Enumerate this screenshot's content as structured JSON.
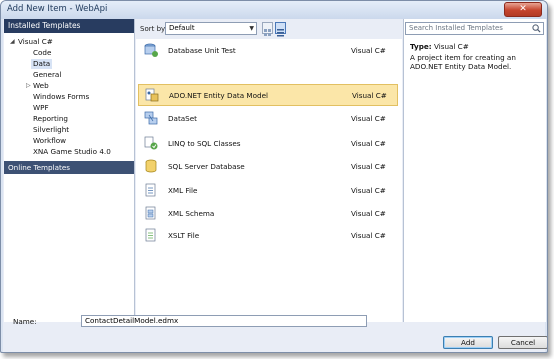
{
  "window": {
    "title": "Add New Item - WebApi",
    "close_glyph": "✕"
  },
  "left": {
    "header": "Installed Templates",
    "tree": [
      {
        "label": "Visual C#",
        "expander": "◢"
      },
      {
        "label": "Code"
      },
      {
        "label": "Data",
        "selected": true
      },
      {
        "label": "General"
      },
      {
        "label": "Web",
        "expander": "▷"
      },
      {
        "label": "Windows Forms"
      },
      {
        "label": "WPF"
      },
      {
        "label": "Reporting"
      },
      {
        "label": "Silverlight"
      },
      {
        "label": "Workflow"
      },
      {
        "label": "XNA Game Studio 4.0"
      }
    ],
    "online": "Online Templates"
  },
  "center": {
    "sort_label": "Sort by:",
    "sort_value": "Default",
    "items": [
      {
        "name": "Database Unit Test",
        "lang": "Visual C#",
        "icon": "database-unit-test-icon"
      },
      {
        "name": "ADO.NET Entity Data Model",
        "lang": "Visual C#",
        "icon": "entity-model-icon",
        "selected": true
      },
      {
        "name": "DataSet",
        "lang": "Visual C#",
        "icon": "dataset-icon"
      },
      {
        "name": "LINQ to SQL Classes",
        "lang": "Visual C#",
        "icon": "linq-icon"
      },
      {
        "name": "SQL Server Database",
        "lang": "Visual C#",
        "icon": "sql-database-icon"
      },
      {
        "name": "XML File",
        "lang": "Visual C#",
        "icon": "xml-file-icon"
      },
      {
        "name": "XML Schema",
        "lang": "Visual C#",
        "icon": "xml-schema-icon"
      },
      {
        "name": "XSLT File",
        "lang": "Visual C#",
        "icon": "xslt-file-icon"
      }
    ]
  },
  "right": {
    "search_placeholder": "Search Installed Templates",
    "type_label": "Type:",
    "type_value": "Visual C#",
    "description": "A project item for creating an ADO.NET Entity Data Model."
  },
  "footer": {
    "name_label": "Name:",
    "name_value": "ContactDetailModel.edmx",
    "add_label": "Add",
    "cancel_label": "Cancel"
  },
  "colors": {
    "selection": "#fbe6a8",
    "left_header": "#283c60",
    "online_header": "#3d5174"
  }
}
